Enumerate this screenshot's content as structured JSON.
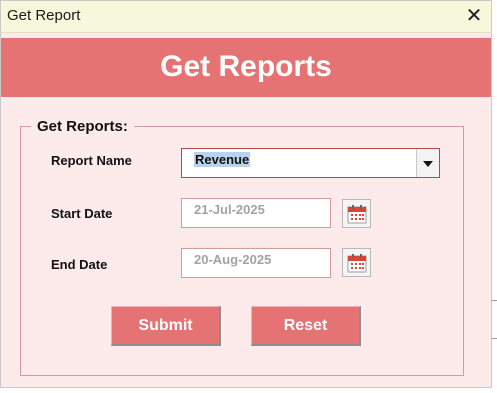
{
  "window": {
    "title": "Get Report",
    "close_glyph": "✕"
  },
  "banner": {
    "title": "Get Reports"
  },
  "form": {
    "group_label": "Get Reports:",
    "report_name": {
      "label": "Report Name",
      "value": "Revenue"
    },
    "start_date": {
      "label": "Start Date",
      "value": "21-Jul-2025",
      "icon": "calendar-icon"
    },
    "end_date": {
      "label": "End Date",
      "value": "20-Aug-2025",
      "icon": "calendar-icon"
    }
  },
  "buttons": {
    "submit": "Submit",
    "reset": "Reset"
  },
  "colors": {
    "banner": "#e57373",
    "form_background": "#fdeaea",
    "title_bar": "#f6f8dc",
    "selection": "#b9d3ef",
    "date_text": "#a3a3a3"
  }
}
